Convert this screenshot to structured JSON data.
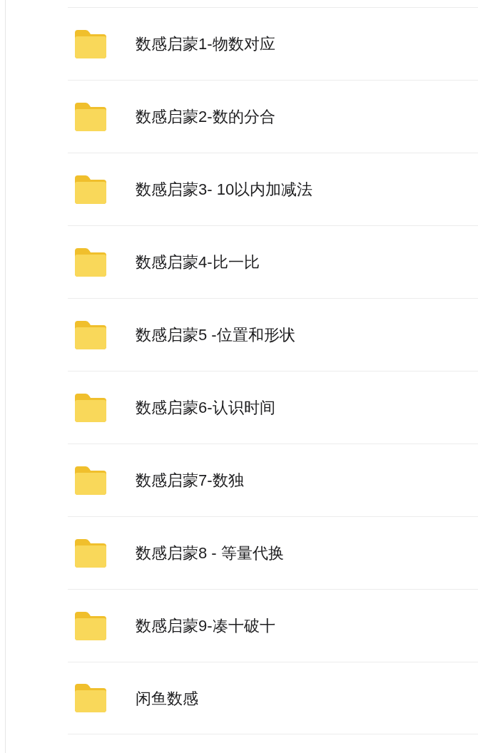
{
  "folders": [
    {
      "name": "数感启蒙1-物数对应"
    },
    {
      "name": "数感启蒙2-数的分合"
    },
    {
      "name": "数感启蒙3- 10以内加减法"
    },
    {
      "name": "数感启蒙4-比一比"
    },
    {
      "name": "数感启蒙5 -位置和形状"
    },
    {
      "name": "数感启蒙6-认识时间"
    },
    {
      "name": "数感启蒙7-数独"
    },
    {
      "name": "数感启蒙8 - 等量代换"
    },
    {
      "name": "数感启蒙9-凑十破十"
    },
    {
      "name": "闲鱼数感"
    }
  ]
}
